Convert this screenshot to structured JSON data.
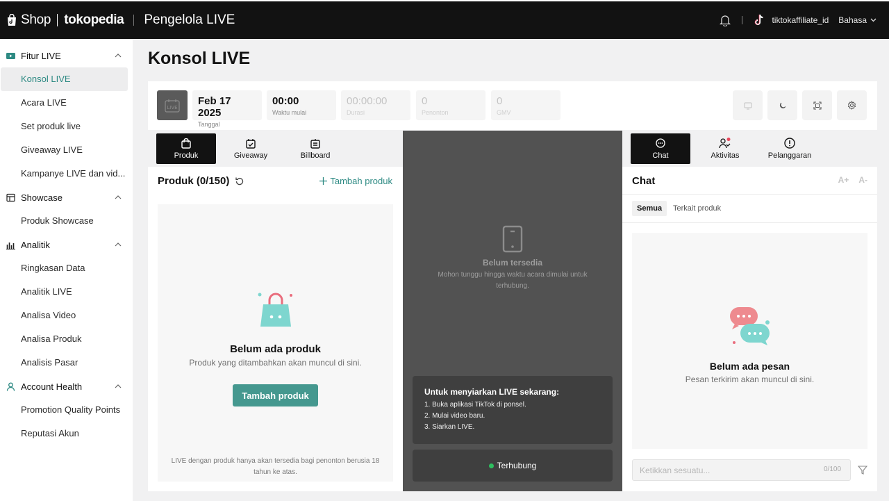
{
  "header": {
    "brand_shop": "Shop",
    "brand_tokopedia": "tokopedia",
    "app_title": "Pengelola LIVE",
    "username": "tiktokaffiliate_id",
    "language": "Bahasa"
  },
  "sidebar": {
    "groups": [
      {
        "label": "Fitur LIVE",
        "items": [
          "Konsol LIVE",
          "Acara LIVE",
          "Set produk live",
          "Giveaway LIVE",
          "Kampanye LIVE dan vid..."
        ]
      },
      {
        "label": "Showcase",
        "items": [
          "Produk Showcase"
        ]
      },
      {
        "label": "Analitik",
        "items": [
          "Ringkasan Data",
          "Analitik LIVE",
          "Analisa Video",
          "Analisa Produk",
          "Analisis Pasar"
        ]
      },
      {
        "label": "Account Health",
        "items": [
          "Promotion Quality Points",
          "Reputasi Akun"
        ]
      }
    ],
    "active_item": "Konsol LIVE"
  },
  "page": {
    "title": "Konsol LIVE",
    "thumb_label": "LIVE"
  },
  "stats": {
    "date_value": "Feb 17 2025",
    "date_label": "Tanggal",
    "start_value": "00:00",
    "start_label": "Waktu mulai",
    "duration_value": "00:00:00",
    "duration_label": "Durasi",
    "viewers_value": "0",
    "viewers_label": "Penonton",
    "gmv_value": "0",
    "gmv_label": "GMV"
  },
  "left_panel": {
    "tabs": [
      "Produk",
      "Giveaway",
      "Billboard"
    ],
    "active_tab": "Produk",
    "heading": "Produk (0/150)",
    "add_link": "Tambah produk",
    "empty_title": "Belum ada produk",
    "empty_sub": "Produk yang ditambahkan akan muncul di sini.",
    "add_button": "Tambah produk",
    "footnote": "LIVE dengan produk hanya akan tersedia bagi penonton berusia 18 tahun ke atas."
  },
  "middle_panel": {
    "title": "Belum tersedia",
    "subtitle": "Mohon tunggu hingga waktu acara dimulai untuk terhubung.",
    "card_heading": "Untuk menyiarkan LIVE sekarang:",
    "steps": [
      "1. Buka aplikasi TikTok di ponsel.",
      "2. Mulai video baru.",
      "3. Siarkan LIVE."
    ],
    "status": "Terhubung",
    "status_color": "#2ebf5f"
  },
  "right_panel": {
    "tabs": [
      "Chat",
      "Aktivitas",
      "Pelanggaran"
    ],
    "active_tab": "Chat",
    "heading": "Chat",
    "font_increase": "A+",
    "font_decrease": "A-",
    "filters": [
      "Semua",
      "Terkait produk"
    ],
    "active_filter": "Semua",
    "empty_title": "Belum ada pesan",
    "empty_sub": "Pesan terkirim akan muncul di sini.",
    "input_placeholder": "Ketikkan sesuatu...",
    "counter": "0/100"
  },
  "colors": {
    "accent": "#2d8a83",
    "button": "#45988f",
    "topbar": "#121212"
  }
}
